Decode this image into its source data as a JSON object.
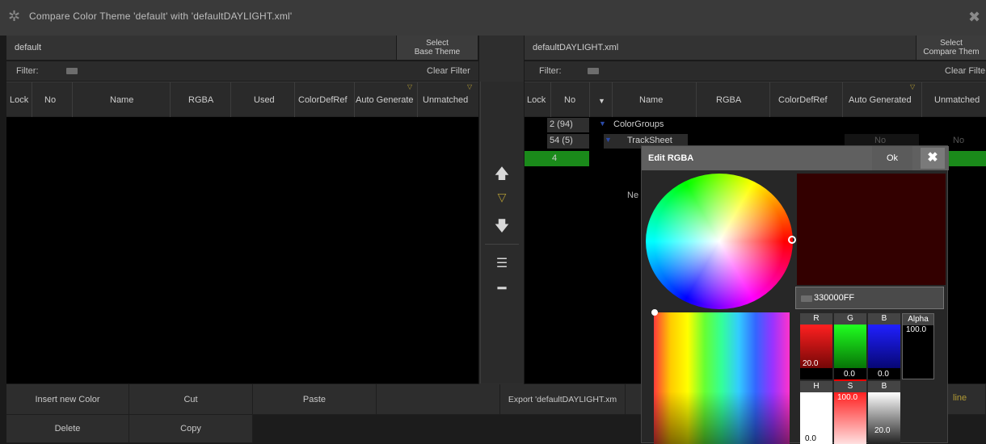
{
  "window": {
    "title": "Compare Color Theme 'default' with 'defaultDAYLIGHT.xml'"
  },
  "left": {
    "theme_name": "default",
    "select_btn": [
      "Select",
      "Base Theme"
    ],
    "filter_label": "Filter:",
    "clear_filter": "Clear Filter",
    "columns": [
      "Lock",
      "No",
      "Name",
      "RGBA",
      "Used",
      "ColorDefRef",
      "Auto Generate",
      "Unmatched"
    ]
  },
  "right": {
    "theme_name": "defaultDAYLIGHT.xml",
    "select_btn": [
      "Select",
      "Compare Them"
    ],
    "filter_label": "Filter:",
    "clear_filter": "Clear Filte",
    "columns": [
      "Lock",
      "No",
      "▼",
      "Name",
      "RGBA",
      "ColorDefRef",
      "Auto Generated",
      "Unmatched"
    ],
    "rows": [
      {
        "no": "2 (94)",
        "name": "ColorGroups",
        "extra": ""
      },
      {
        "no": "54 (5)",
        "name": "TrackSheet",
        "extra": "No"
      },
      {
        "no": "4",
        "name": "",
        "extra": ""
      }
    ],
    "partial_text": "Ne",
    "partial_line": "line",
    "row2_no2": "No"
  },
  "middle_buttons": [
    "up-arrow",
    "filter",
    "down-arrow",
    "list",
    "minus"
  ],
  "bottom": {
    "row1": [
      "Insert new Color",
      "Cut",
      "Paste",
      "",
      "Export 'defaultDAYLIGHT.xm"
    ],
    "row2": [
      "Delete",
      "Copy"
    ]
  },
  "dialog": {
    "title": "Edit RGBA",
    "ok": "Ok",
    "hex": "330000FF",
    "preview_color": "#330000",
    "channels": [
      {
        "label": "R",
        "value": "20.0",
        "fill": 0.2,
        "color": "#cc0000"
      },
      {
        "label": "G",
        "value": "0.0",
        "fill": 0.0,
        "color": "#00cc00"
      },
      {
        "label": "B",
        "value": "0.0",
        "fill": 0.0,
        "color": "#0000cc"
      },
      {
        "label": "Alpha",
        "value": "100.0",
        "fill": 1.0,
        "color": "#000000"
      }
    ],
    "hsb": [
      {
        "label": "H",
        "value": "0.0"
      },
      {
        "label": "S",
        "value": "100.0"
      },
      {
        "label": "B",
        "value": "20.0"
      }
    ]
  },
  "colors": {
    "accent_green": "#1a8a1a",
    "dialog_header": "#606060"
  }
}
